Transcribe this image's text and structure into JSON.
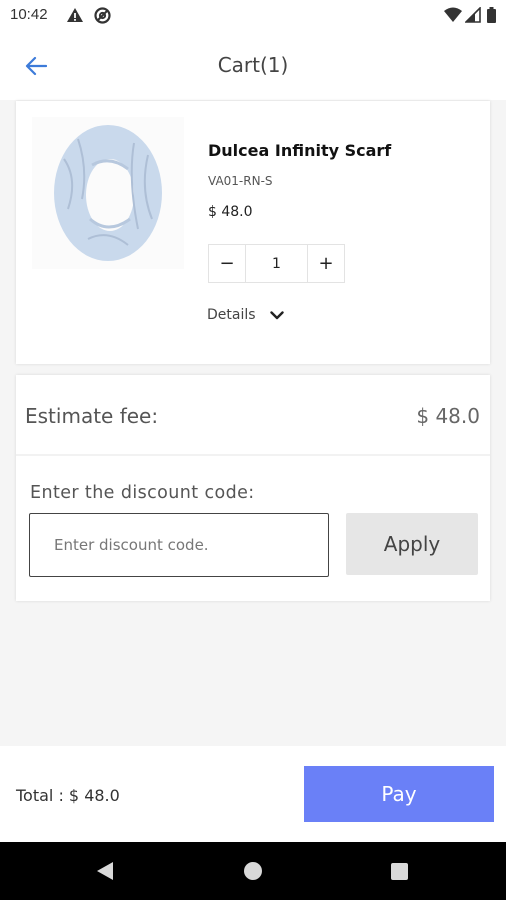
{
  "status_bar": {
    "time": "10:42",
    "icons": [
      "alert-icon",
      "at-sign-icon",
      "wifi-icon",
      "cellular-icon",
      "battery-icon"
    ]
  },
  "header": {
    "title": "Cart(1)",
    "back_icon": "arrow-left-icon",
    "accent_color": "#3d7bd9"
  },
  "cart_item": {
    "name": "Dulcea Infinity Scarf",
    "sku": "VA01-RN-S",
    "price": "$ 48.0",
    "quantity": "1",
    "decrement_label": "−",
    "increment_label": "+",
    "details_label": "Details",
    "details_icon": "chevron-down-icon",
    "image": "scarf-image"
  },
  "summary": {
    "estimate_label": "Estimate fee:",
    "estimate_value": "$ 48.0",
    "discount_label": "Enter the discount code:",
    "discount_placeholder": "Enter discount code.",
    "discount_value": "",
    "apply_label": "Apply"
  },
  "footer": {
    "total_text": "Total : $ 48.0",
    "pay_label": "Pay",
    "pay_color": "#6a80f7"
  },
  "nav_bar": {
    "buttons": [
      "back-triangle-icon",
      "home-circle-icon",
      "recents-square-icon"
    ]
  }
}
